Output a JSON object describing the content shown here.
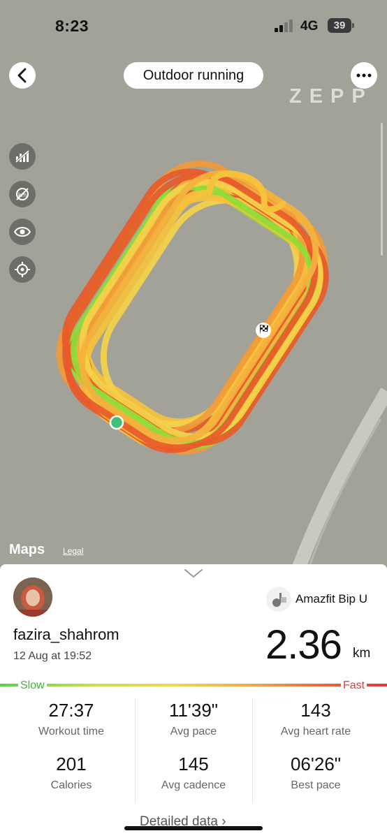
{
  "status_bar": {
    "time": "8:23",
    "network": "4G",
    "battery": "39"
  },
  "header": {
    "title": "Outdoor running",
    "brand": "ZEPP"
  },
  "map": {
    "attribution": "Maps",
    "legal_label": "Legal",
    "controls": [
      "hide-pace-icon",
      "hide-km-markers-icon",
      "eye-icon",
      "locate-icon"
    ]
  },
  "profile": {
    "username": "fazira_shahrom",
    "date": "12 Aug at 19:52"
  },
  "device": {
    "name": "Amazfit Bip U"
  },
  "summary": {
    "distance": "2.36",
    "unit": "km"
  },
  "pace_scale": {
    "slow_label": "Slow",
    "fast_label": "Fast"
  },
  "stats": [
    {
      "value": "27:37",
      "label": "Workout time"
    },
    {
      "value": "11'39\"",
      "label": "Avg pace"
    },
    {
      "value": "143",
      "label": "Avg heart rate"
    },
    {
      "value": "201",
      "label": "Calories"
    },
    {
      "value": "145",
      "label": "Avg cadence"
    },
    {
      "value": "06'26\"",
      "label": "Best pace"
    }
  ],
  "footer": {
    "detailed_label": "Detailed data"
  },
  "colors": {
    "route_slow": "#8fdc3a",
    "route_mid": "#f6c23c",
    "route_fast": "#e85a2a",
    "fast_text": "#e23a3a",
    "slow_text": "#3db43a"
  }
}
